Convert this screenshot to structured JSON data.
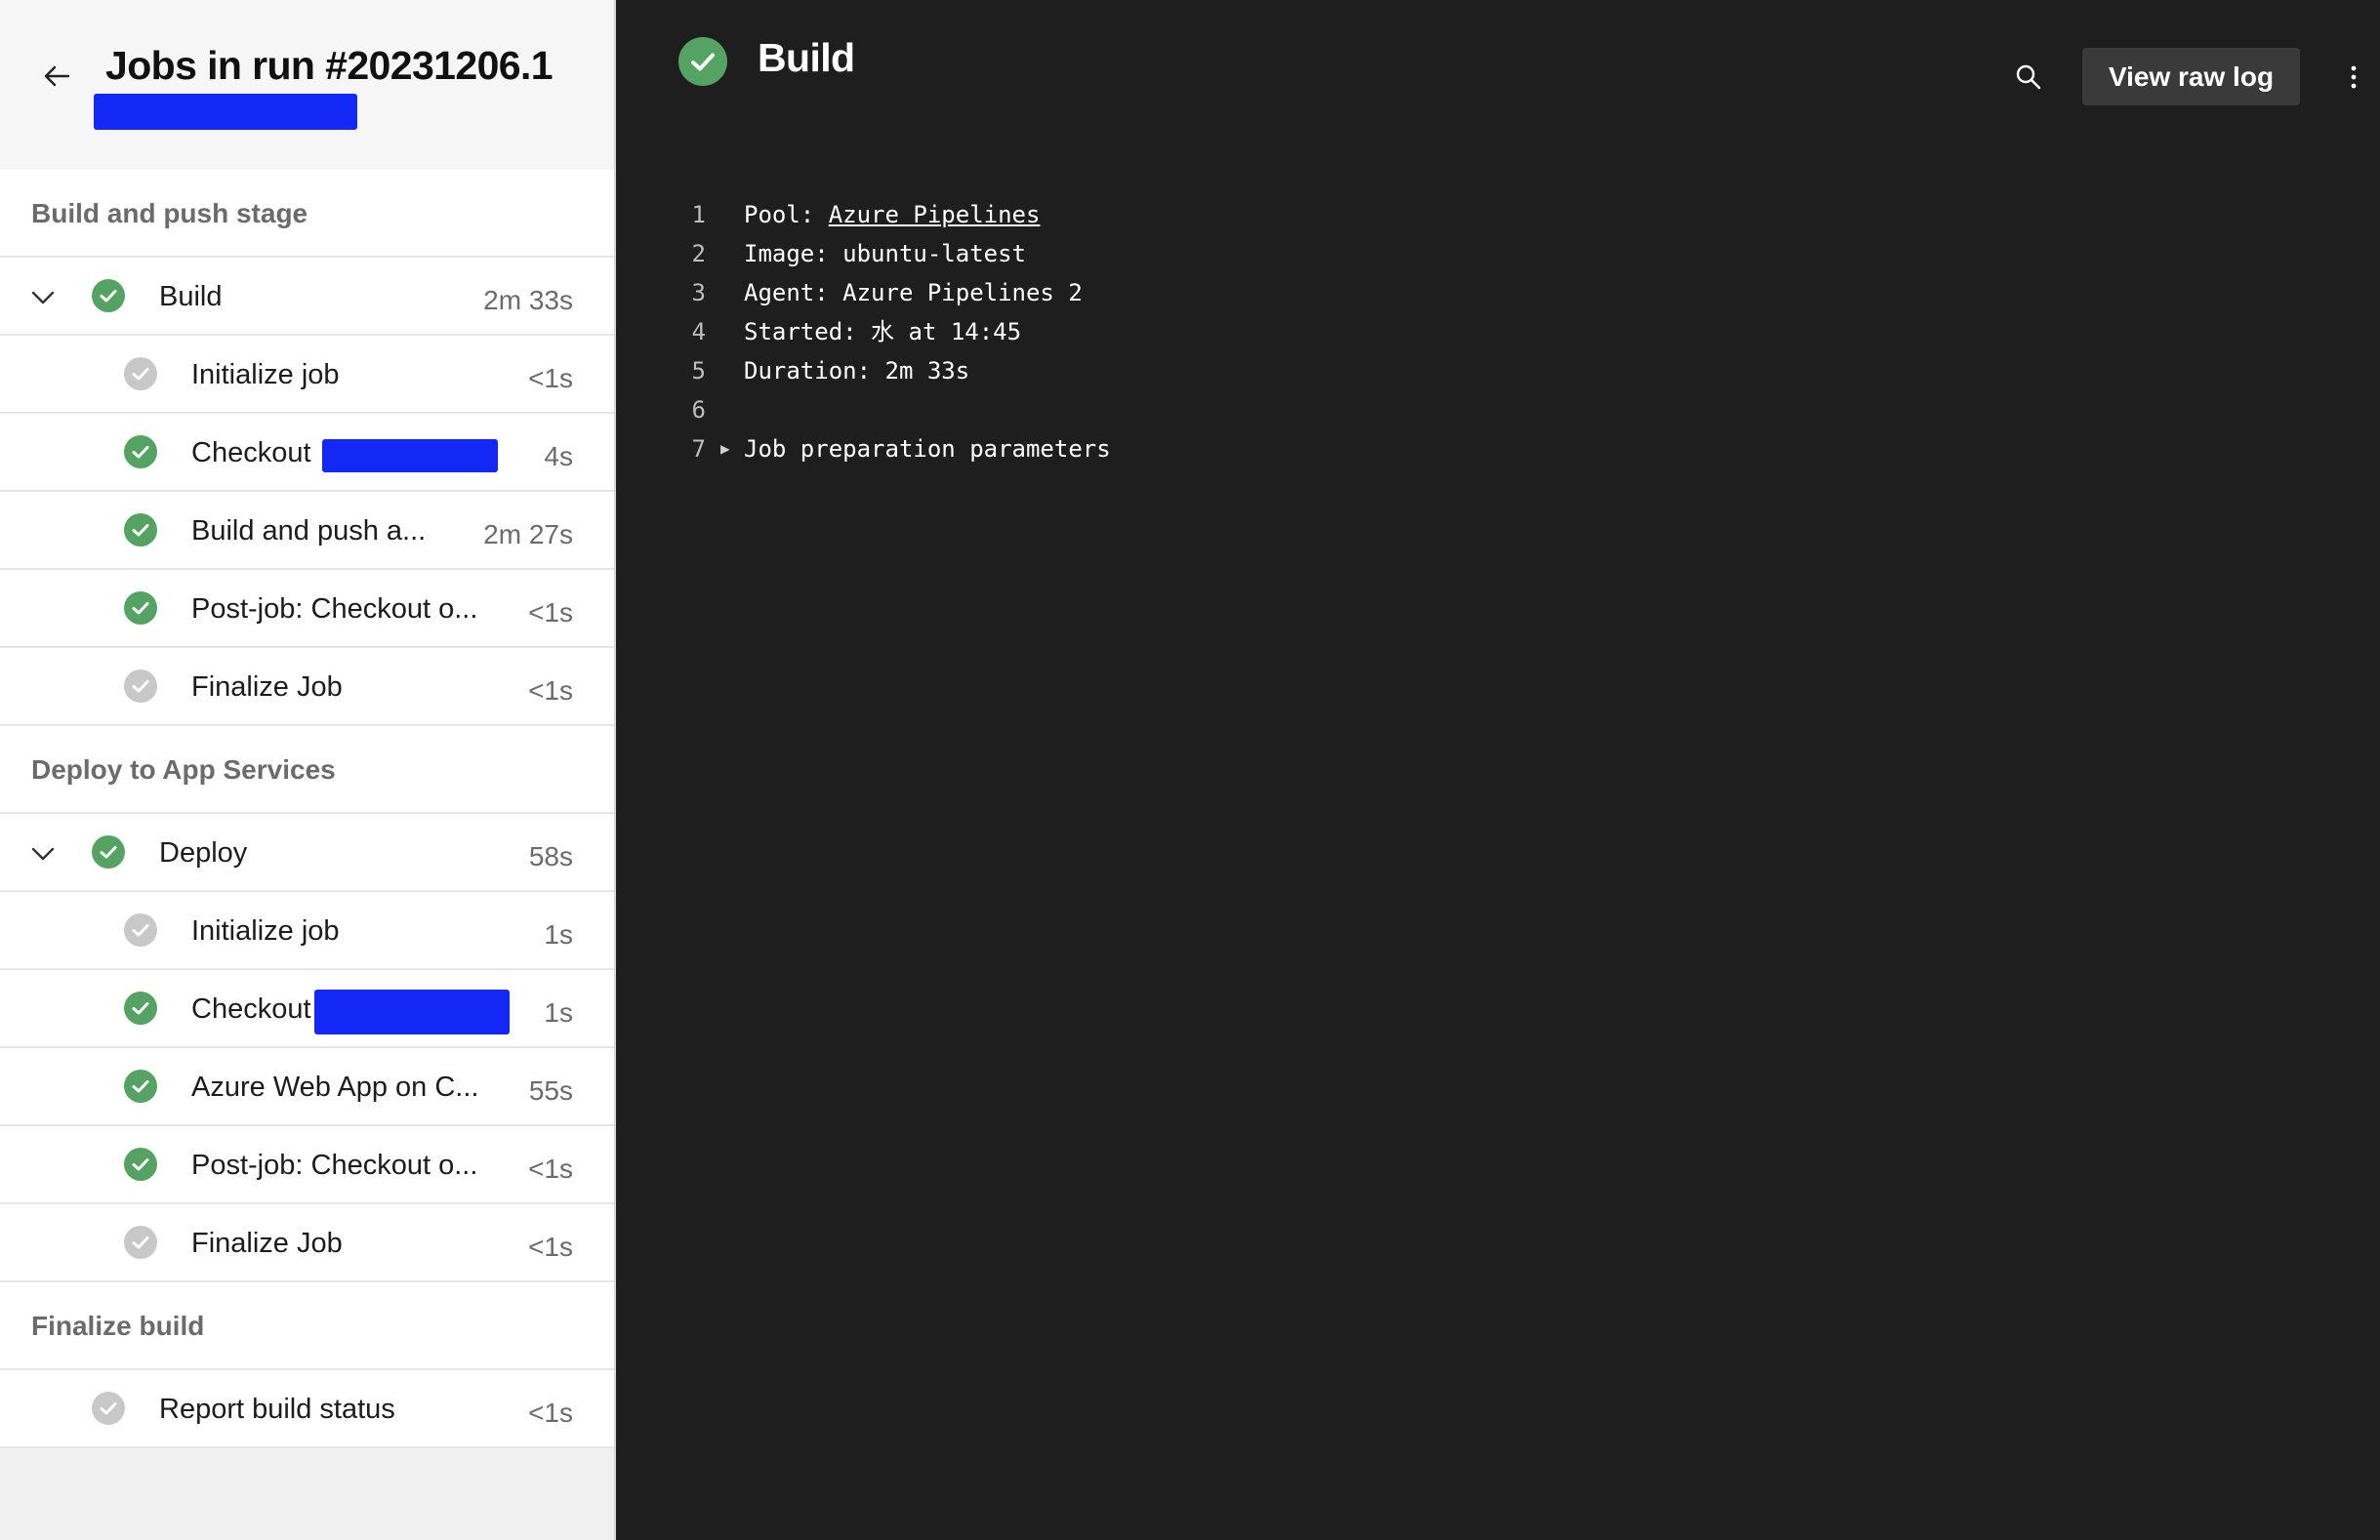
{
  "sidebar": {
    "title": "Jobs in run #20231206.1",
    "stages": [
      {
        "name": "Build and push stage",
        "job": {
          "label": "Build",
          "duration": "2m 33s",
          "status": "succeeded"
        },
        "steps": [
          {
            "label": "Initialize job",
            "duration": "<1s",
            "status": "skipped"
          },
          {
            "label": "Checkout",
            "duration": "4s",
            "status": "succeeded"
          },
          {
            "label": "Build and push a...",
            "duration": "2m 27s",
            "status": "succeeded"
          },
          {
            "label": "Post-job: Checkout o...",
            "duration": "<1s",
            "status": "succeeded"
          },
          {
            "label": "Finalize Job",
            "duration": "<1s",
            "status": "skipped"
          }
        ]
      },
      {
        "name": "Deploy to App Services",
        "job": {
          "label": "Deploy",
          "duration": "58s",
          "status": "succeeded"
        },
        "steps": [
          {
            "label": "Initialize job",
            "duration": "1s",
            "status": "skipped"
          },
          {
            "label": "Checkout",
            "duration": "1s",
            "status": "succeeded"
          },
          {
            "label": "Azure Web App on C...",
            "duration": "55s",
            "status": "succeeded"
          },
          {
            "label": "Post-job: Checkout o...",
            "duration": "<1s",
            "status": "succeeded"
          },
          {
            "label": "Finalize Job",
            "duration": "<1s",
            "status": "skipped"
          }
        ]
      },
      {
        "name": "Finalize build",
        "job": {
          "label": "Report build status",
          "duration": "<1s",
          "status": "skipped"
        }
      }
    ]
  },
  "log_panel": {
    "title": "Build",
    "view_raw_label": "View raw log",
    "lines": [
      {
        "num": "1",
        "prefix": "Pool: ",
        "link": "Azure Pipelines"
      },
      {
        "num": "2",
        "text": "Image: ubuntu-latest"
      },
      {
        "num": "3",
        "text": "Agent: Azure Pipelines 2"
      },
      {
        "num": "4",
        "text": "Started: 水 at 14:45"
      },
      {
        "num": "5",
        "text": "Duration: 2m 33s"
      },
      {
        "num": "6",
        "text": ""
      },
      {
        "num": "7",
        "text": "Job preparation parameters"
      }
    ]
  },
  "colors": {
    "success": "#55a362",
    "skipped": "#c8c8c8",
    "redaction": "#1328f5",
    "log_background": "#1e1e1e"
  },
  "icons": [
    "arrow-left-icon",
    "check-icon",
    "chevron-down-icon",
    "search-icon",
    "more-vertical-icon",
    "triangle-right-icon"
  ]
}
